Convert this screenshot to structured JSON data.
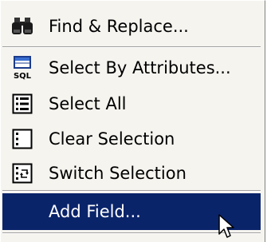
{
  "menu": {
    "items": [
      {
        "label": "Find & Replace...",
        "icon": "binoculars-icon"
      },
      {
        "label": "Select By Attributes...",
        "icon": "sql-table-icon"
      },
      {
        "label": "Select All",
        "icon": "select-all-icon"
      },
      {
        "label": "Clear Selection",
        "icon": "clear-selection-icon"
      },
      {
        "label": "Switch Selection",
        "icon": "switch-selection-icon"
      },
      {
        "label": "Add Field...",
        "icon": "",
        "highlighted": true
      }
    ],
    "sql_badge_text": "SQL",
    "highlight_color": "#0a246a",
    "background_color": "#f5f4ef"
  }
}
